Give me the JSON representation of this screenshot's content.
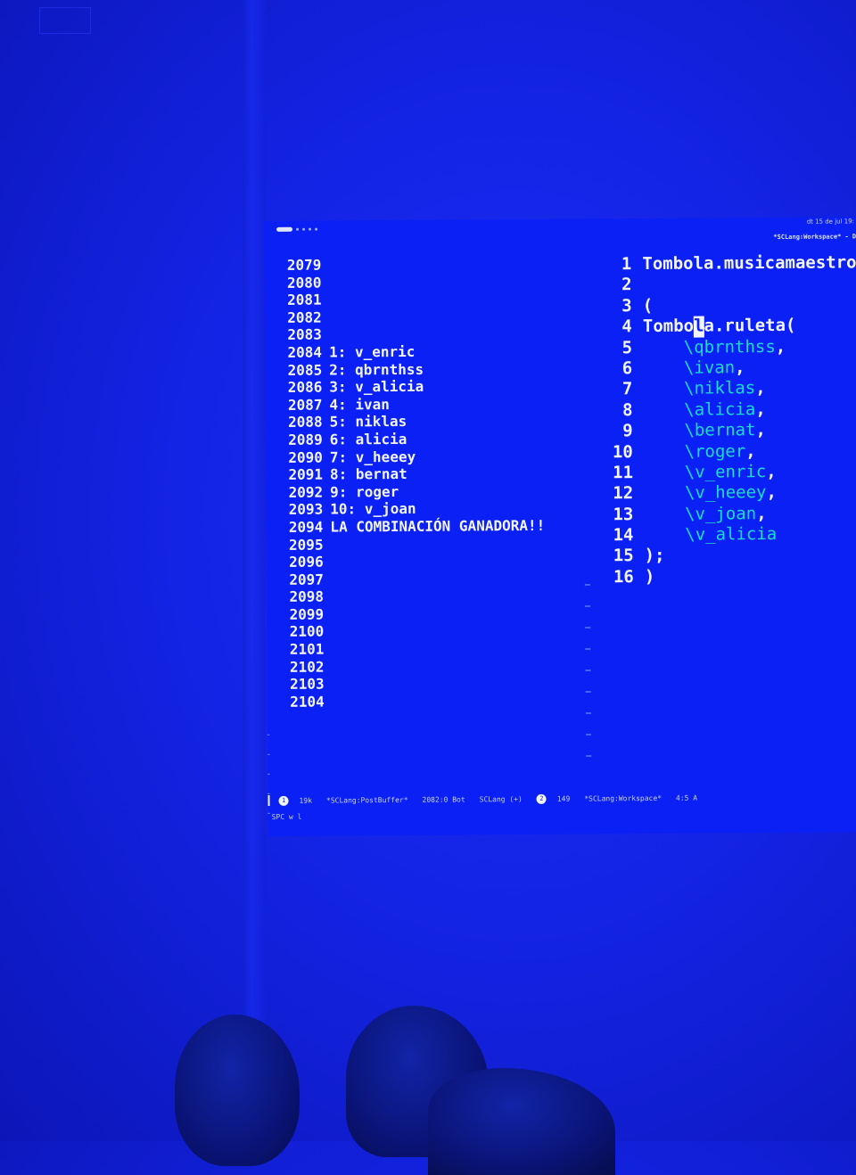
{
  "top_bar": {
    "clock": "dt 15 de jul 19:",
    "window_title": "*SCLang:Workspace* - D"
  },
  "post_buffer": {
    "lines": [
      {
        "num": "2079",
        "text": ""
      },
      {
        "num": "2080",
        "text": ""
      },
      {
        "num": "2081",
        "text": ""
      },
      {
        "num": "2082",
        "text": ""
      },
      {
        "num": "2083",
        "text": ""
      },
      {
        "num": "2084",
        "text": "1: v_enric"
      },
      {
        "num": "2085",
        "text": "2: qbrnthss"
      },
      {
        "num": "2086",
        "text": "3: v_alicia"
      },
      {
        "num": "2087",
        "text": "4: ivan"
      },
      {
        "num": "2088",
        "text": "5: niklas"
      },
      {
        "num": "2089",
        "text": "6: alicia"
      },
      {
        "num": "2090",
        "text": "7: v_heeey"
      },
      {
        "num": "2091",
        "text": "8: bernat"
      },
      {
        "num": "2092",
        "text": "9: roger"
      },
      {
        "num": "2093",
        "text": "10: v_joan"
      },
      {
        "num": "2094",
        "text": "LA COMBINACIÓN GANADORA!!"
      },
      {
        "num": "2095",
        "text": ""
      },
      {
        "num": "2096",
        "text": ""
      },
      {
        "num": "2097",
        "text": ""
      },
      {
        "num": "2098",
        "text": ""
      },
      {
        "num": "2099",
        "text": ""
      },
      {
        "num": "2100",
        "text": ""
      },
      {
        "num": "2101",
        "text": ""
      },
      {
        "num": "2102",
        "text": ""
      },
      {
        "num": "2103",
        "text": ""
      },
      {
        "num": "2104",
        "text": ""
      }
    ]
  },
  "workspace": {
    "lines": [
      {
        "num": "1",
        "pre": "Tombola.musicamaestro",
        "sym": "",
        "post": ""
      },
      {
        "num": "2",
        "pre": "",
        "sym": "",
        "post": ""
      },
      {
        "num": "3",
        "pre": "(",
        "sym": "",
        "post": ""
      },
      {
        "num": "4",
        "pre": "",
        "sym": "",
        "post": ""
      },
      {
        "num": "5",
        "pre": "    ",
        "sym": "\\qbrnthss",
        "post": ","
      },
      {
        "num": "6",
        "pre": "    ",
        "sym": "\\ivan",
        "post": ","
      },
      {
        "num": "7",
        "pre": "    ",
        "sym": "\\niklas",
        "post": ","
      },
      {
        "num": "8",
        "pre": "    ",
        "sym": "\\alicia",
        "post": ","
      },
      {
        "num": "9",
        "pre": "    ",
        "sym": "\\bernat",
        "post": ","
      },
      {
        "num": "10",
        "pre": "    ",
        "sym": "\\roger",
        "post": ","
      },
      {
        "num": "11",
        "pre": "    ",
        "sym": "\\v_enric",
        "post": ","
      },
      {
        "num": "12",
        "pre": "    ",
        "sym": "\\v_heeey",
        "post": ","
      },
      {
        "num": "13",
        "pre": "    ",
        "sym": "\\v_joan",
        "post": ","
      },
      {
        "num": "14",
        "pre": "    ",
        "sym": "\\v_alicia",
        "post": ""
      },
      {
        "num": "15",
        "pre": ");",
        "sym": "",
        "post": ""
      },
      {
        "num": "16",
        "pre": ")",
        "sym": "",
        "post": ""
      }
    ],
    "cursor_line": {
      "before": "Tombo",
      "cursor_char": "l",
      "after": "a.ruleta("
    }
  },
  "modeline": {
    "left_dot": "1",
    "left_size": "19k",
    "left_buffer": "*SCLang:PostBuffer*",
    "left_pos": "2082:0 Bot",
    "left_mode": "SCLang (+)",
    "right_dot": "2",
    "right_size": "149",
    "right_buffer": "*SCLang:Workspace*",
    "right_pos": "4:5 A"
  },
  "minibuffer": {
    "text": "SPC w l"
  },
  "colors": {
    "background": "#0a20f4",
    "text": "#f2f5ff",
    "symbol": "#19dcd2"
  }
}
